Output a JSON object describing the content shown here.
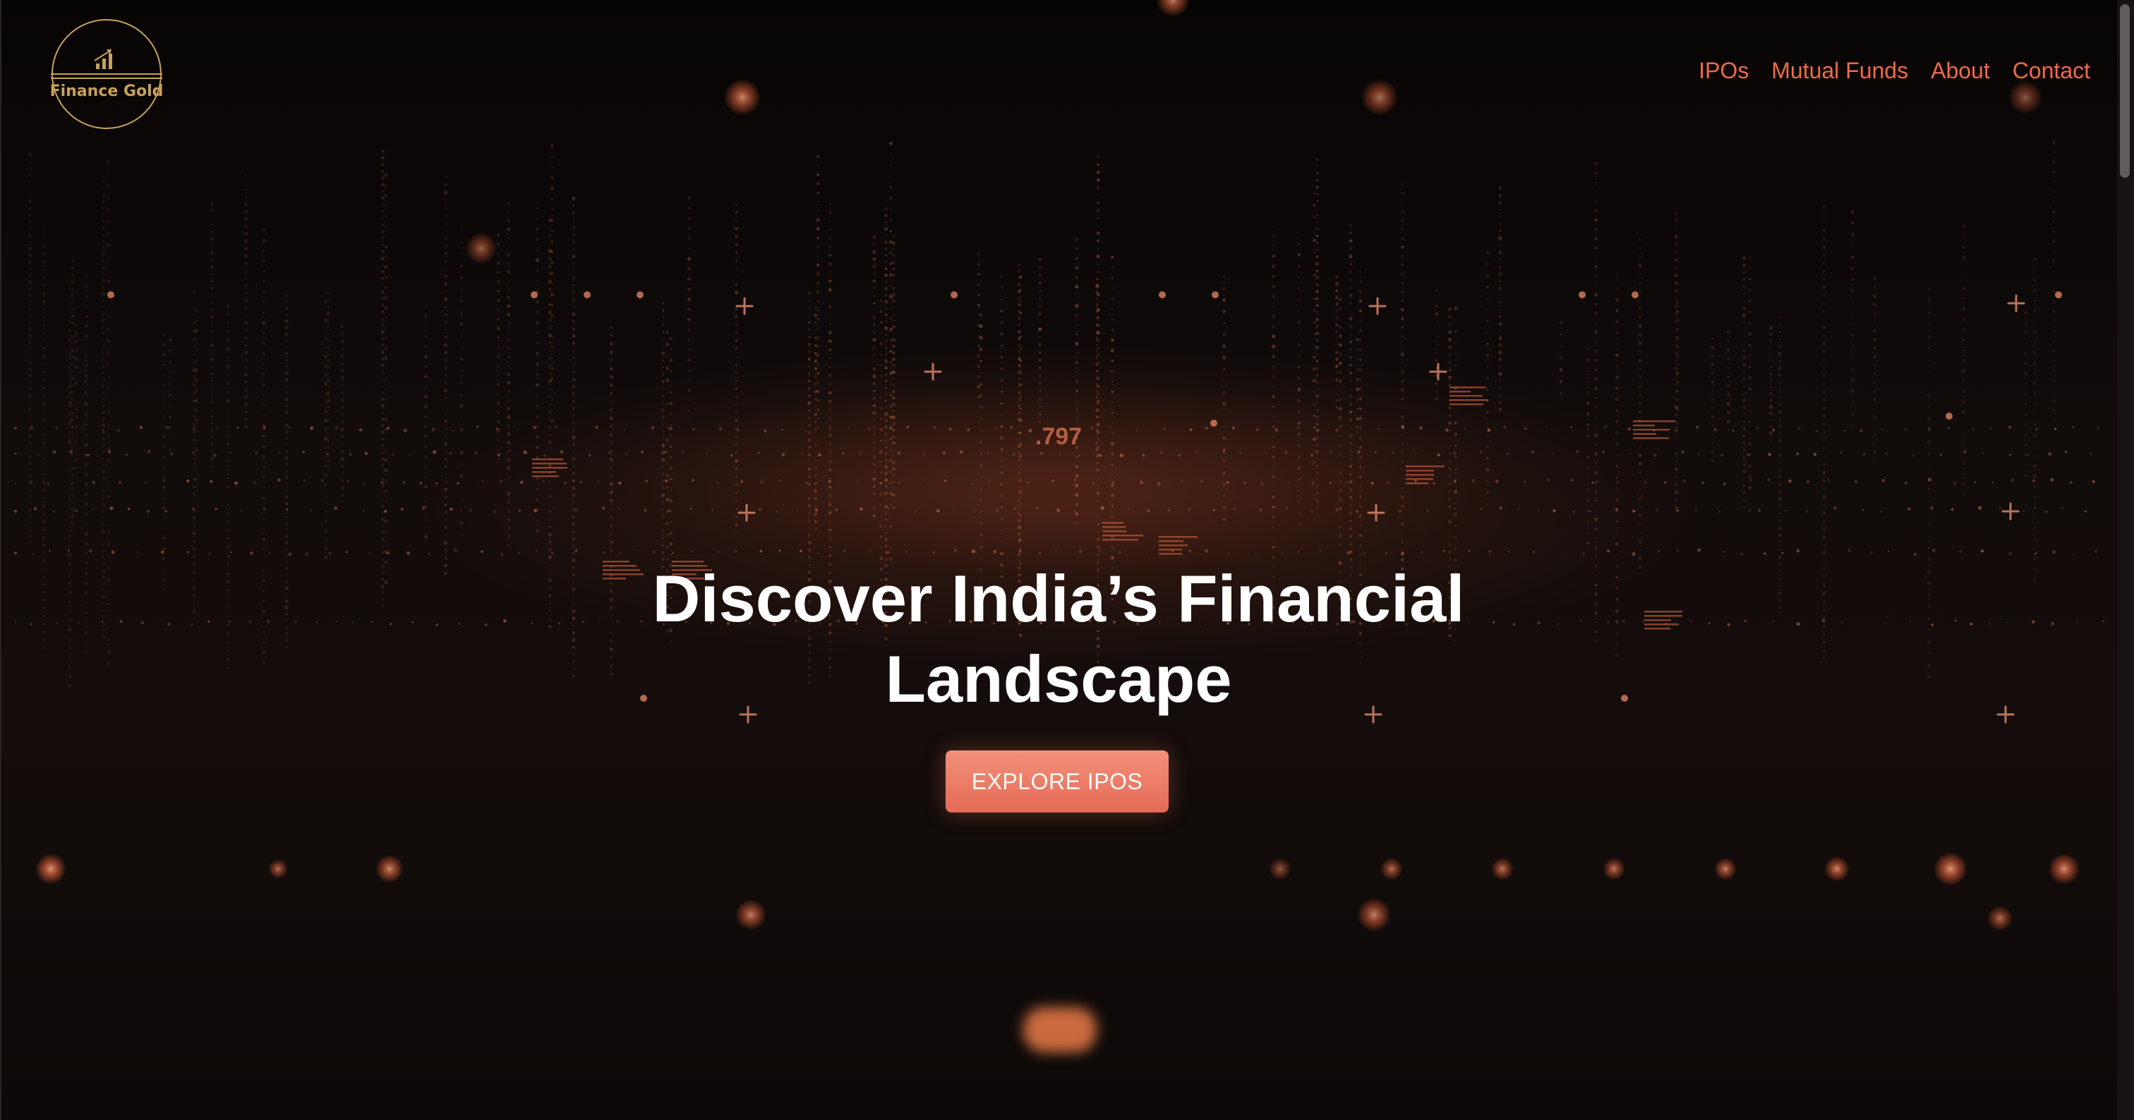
{
  "brand": {
    "name": "Finance Gold",
    "color": "#c9a15a"
  },
  "nav": {
    "items": [
      {
        "label": "IPOs"
      },
      {
        "label": "Mutual Funds"
      },
      {
        "label": "About"
      },
      {
        "label": "Contact"
      }
    ],
    "color": "#ef6a4a"
  },
  "hero": {
    "headline": "Discover India’s Financial Landscape",
    "cta_label": "EXPLORE IPOS",
    "background_readout": ".797"
  },
  "colors": {
    "accent": "#e46a54",
    "background": "#0f0a09",
    "glow": "#f07a4e"
  },
  "icons": {
    "logo": "bar-chart-icon"
  }
}
